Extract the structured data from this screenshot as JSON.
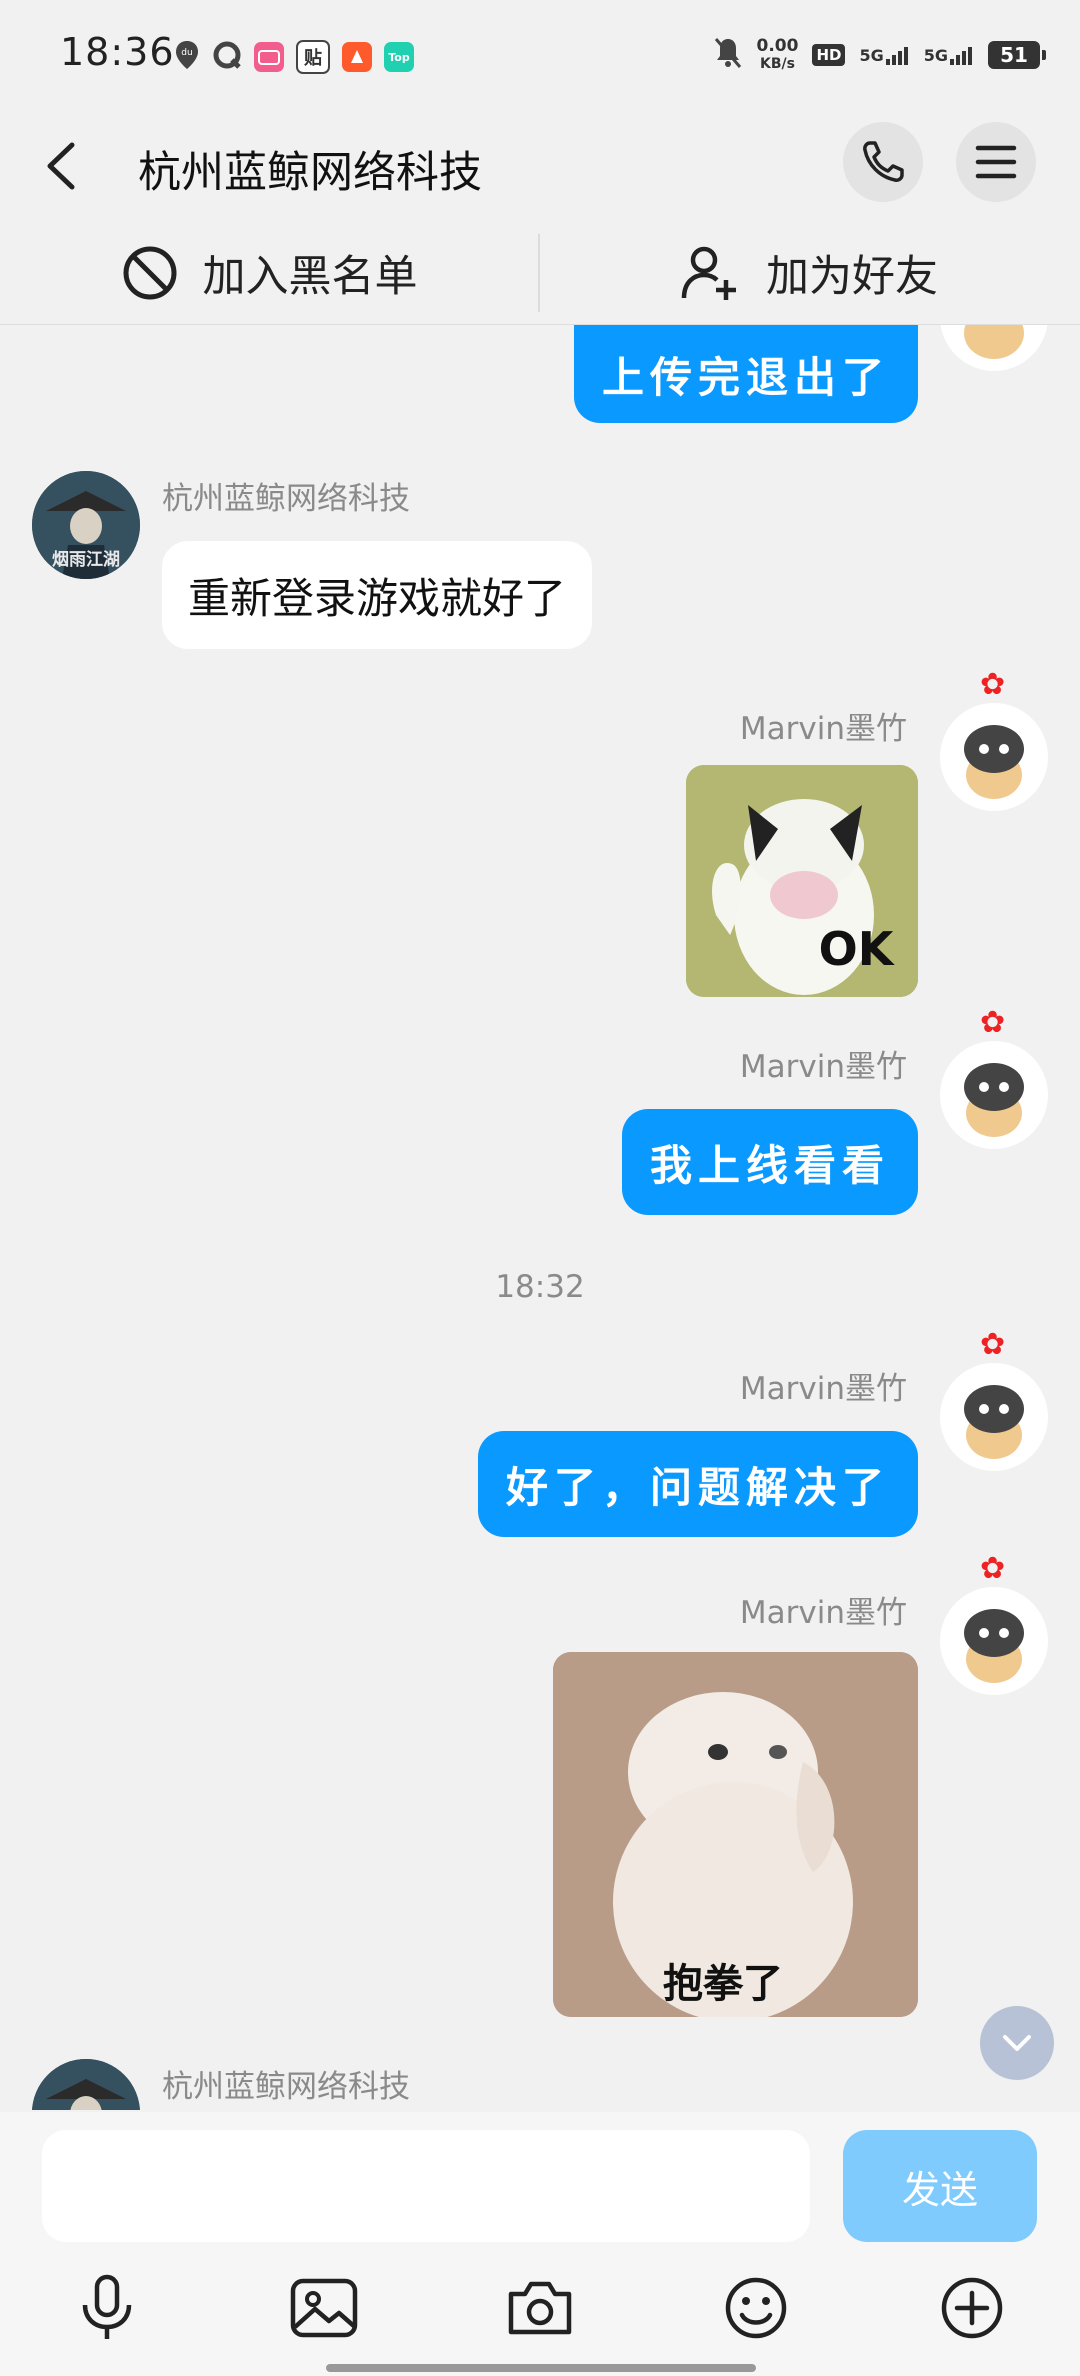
{
  "status_bar": {
    "time": "18:36",
    "net_speed_value": "0.00",
    "net_speed_unit": "KB/s",
    "hd_label": "HD",
    "signal_1": "5G",
    "signal_2": "5G",
    "battery": "51",
    "app_icons": [
      "du",
      "Q",
      "bilibili",
      "贴",
      "taobao",
      "Top"
    ]
  },
  "header": {
    "title": "杭州蓝鲸网络科技",
    "icons": [
      "back-arrow-icon",
      "phone-icon",
      "menu-icon"
    ]
  },
  "actions": {
    "blacklist_label": "加入黑名单",
    "add_friend_label": "加为好友"
  },
  "messages": [
    {
      "side": "right",
      "type": "text",
      "text": "上传完退出了"
    },
    {
      "side": "left",
      "sender": "杭州蓝鲸网络科技",
      "type": "text",
      "text": "重新登录游戏就好了"
    },
    {
      "side": "right",
      "sender": "Marvin墨竹",
      "type": "sticker",
      "caption": "OK"
    },
    {
      "side": "right",
      "sender": "Marvin墨竹",
      "type": "text",
      "text": "我上线看看"
    },
    {
      "type": "timestamp",
      "text": "18:32"
    },
    {
      "side": "right",
      "sender": "Marvin墨竹",
      "type": "text",
      "text": "好了，问题解决了"
    },
    {
      "side": "right",
      "sender": "Marvin墨竹",
      "type": "sticker",
      "caption": "抱拳了"
    },
    {
      "side": "left",
      "sender": "杭州蓝鲸网络科技",
      "type": "partial"
    }
  ],
  "avatar_left_text": "烟雨江湖",
  "composer": {
    "placeholder": "",
    "send_label": "发送",
    "toolbar": [
      "microphone-icon",
      "image-icon",
      "camera-icon",
      "emoji-icon",
      "plus-icon"
    ]
  },
  "colors": {
    "accent_blue": "#0a99ff",
    "send_disabled": "#7fcbfd",
    "background": "#f1f1f1"
  }
}
